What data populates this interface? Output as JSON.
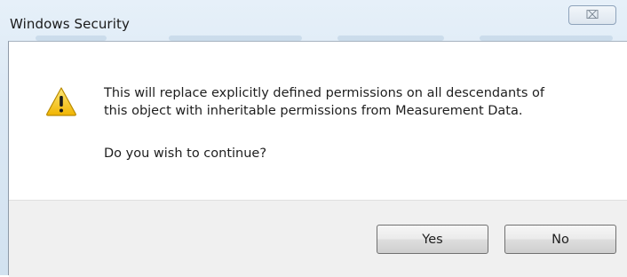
{
  "window": {
    "title": "Windows Security",
    "close_glyph": "⌧"
  },
  "dialog": {
    "icon": "warning-icon",
    "message_lines": [
      "This will replace explicitly defined permissions on all descendants of",
      "this object with inheritable permissions from Measurement Data."
    ],
    "question": "Do you wish to continue?"
  },
  "buttons": {
    "yes_label": "Yes",
    "no_label": "No"
  },
  "colors": {
    "title_bar": "#dbe8f4",
    "footer": "#f0f0f0",
    "warning_yellow": "#f5c518"
  }
}
